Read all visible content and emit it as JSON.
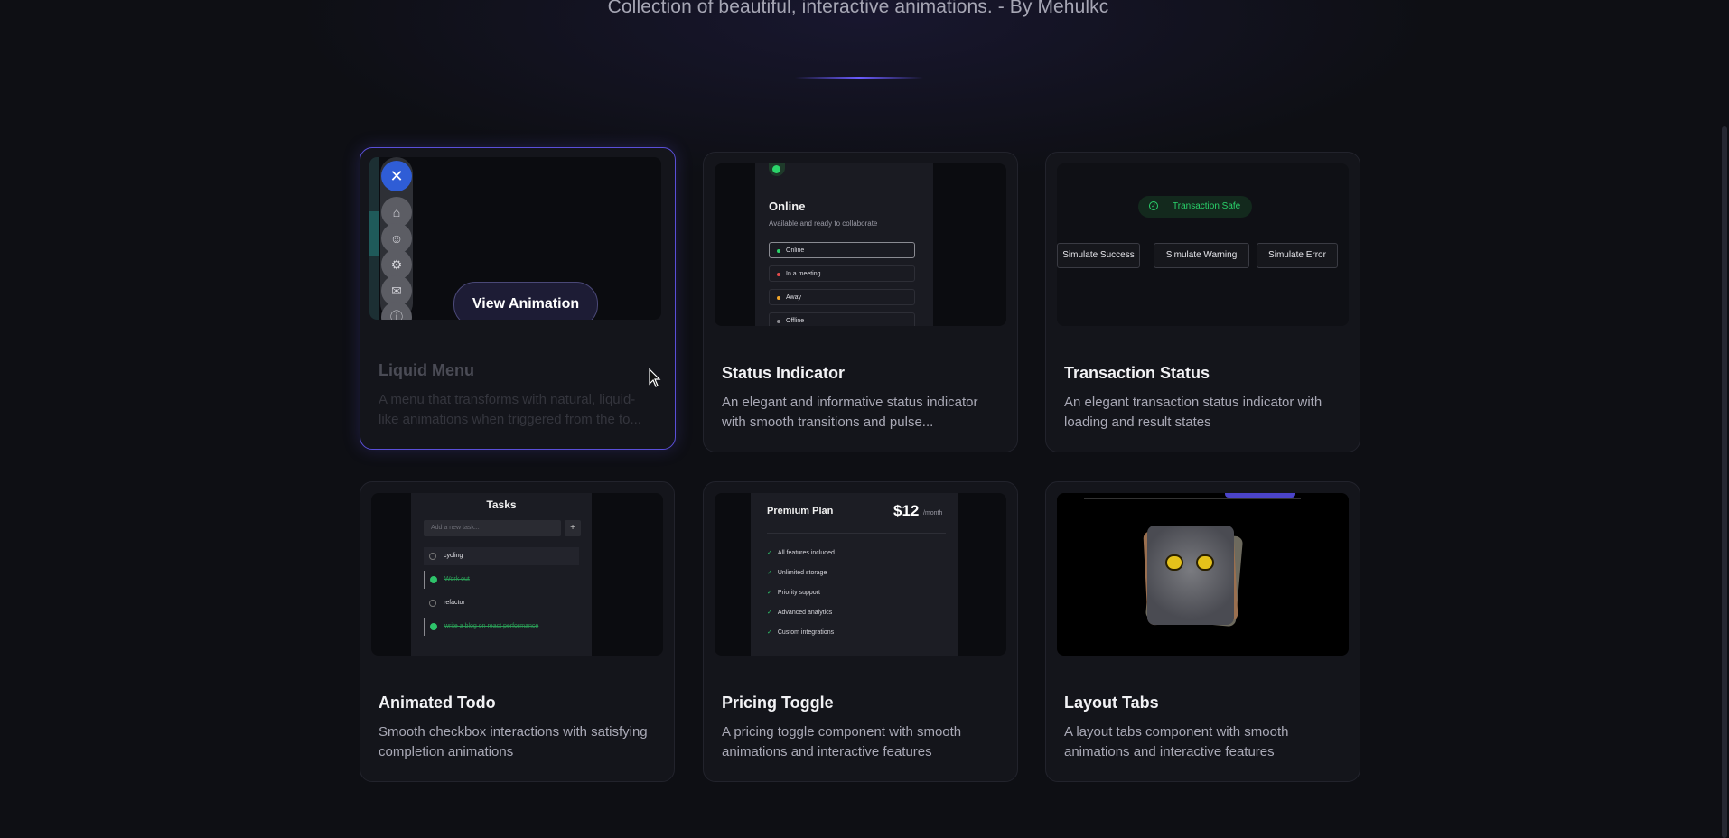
{
  "header": {
    "subtitle": "Collection of beautiful, interactive animations. - By Mehulkc"
  },
  "cards": [
    {
      "title": "Liquid Menu",
      "description": "A menu that transforms with natural, liquid-like animations when triggered from the to...",
      "hover_button": "View Animation",
      "preview": {
        "menu_icons": [
          "close-icon",
          "home-icon",
          "user-icon",
          "gear-icon",
          "mail-icon",
          "info-icon"
        ]
      }
    },
    {
      "title": "Status Indicator",
      "description": "An elegant and informative status indicator with smooth transitions and pulse...",
      "preview": {
        "heading": "Online",
        "sub": "Available and ready to collaborate",
        "options": [
          {
            "label": "Online",
            "color": "#2bd46a"
          },
          {
            "label": "In a meeting",
            "color": "#e24b4b"
          },
          {
            "label": "Away",
            "color": "#f0a52a"
          },
          {
            "label": "Offline",
            "color": "#8a8a90"
          }
        ]
      }
    },
    {
      "title": "Transaction Status",
      "description": "An elegant transaction status indicator with loading and result states",
      "preview": {
        "status": "Transaction Safe",
        "buttons": [
          "Simulate Success",
          "Simulate Warning",
          "Simulate Error"
        ]
      }
    },
    {
      "title": "Animated Todo",
      "description": "Smooth checkbox interactions with satisfying completion animations",
      "preview": {
        "heading": "Tasks",
        "placeholder": "Add a new task...",
        "add": "+",
        "items": [
          {
            "label": "cycling",
            "done": false
          },
          {
            "label": "Work out",
            "done": true
          },
          {
            "label": "refactor",
            "done": false
          },
          {
            "label": "write a blog on react performance",
            "done": true
          }
        ]
      }
    },
    {
      "title": "Pricing Toggle",
      "description": "A pricing toggle component with smooth animations and interactive features",
      "preview": {
        "plan": "Premium Plan",
        "price": "$12",
        "period": "/month",
        "features": [
          "All features included",
          "Unlimited storage",
          "Priority support",
          "Advanced analytics",
          "Custom integrations"
        ]
      }
    },
    {
      "title": "Layout Tabs",
      "description": "A layout tabs component with smooth animations and interactive features",
      "preview": {}
    }
  ],
  "colors": {
    "accent": "#5a4fd8",
    "success": "#2ec36a",
    "background": "#0e0f14"
  }
}
